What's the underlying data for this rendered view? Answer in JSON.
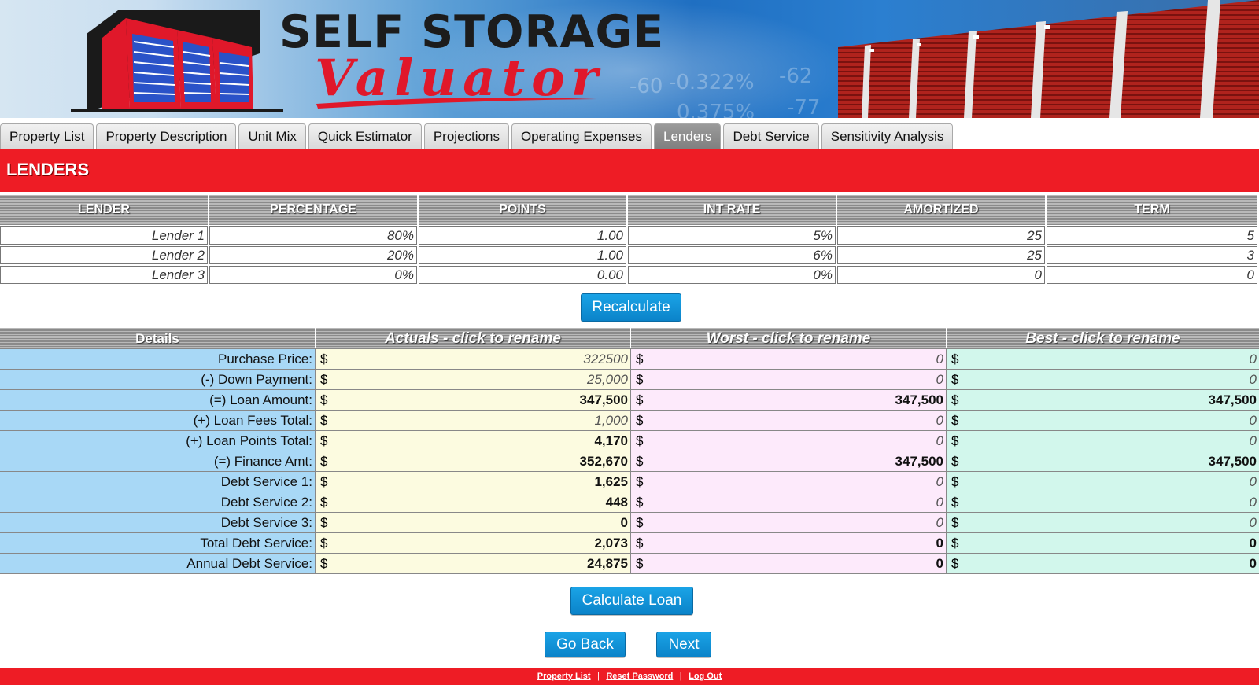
{
  "brand": {
    "line1": "SELF STORAGE",
    "line2": "Valuator"
  },
  "banner_ticker": [
    "-60",
    "-0.322%",
    "-62",
    "0.375%",
    "-77"
  ],
  "tabs": [
    {
      "label": "Property List"
    },
    {
      "label": "Property Description"
    },
    {
      "label": "Unit Mix"
    },
    {
      "label": "Quick Estimator"
    },
    {
      "label": "Projections"
    },
    {
      "label": "Operating Expenses"
    },
    {
      "label": "Lenders",
      "active": true
    },
    {
      "label": "Debt Service"
    },
    {
      "label": "Sensitivity Analysis"
    }
  ],
  "section": {
    "title": "LENDERS"
  },
  "lenders_table": {
    "headers": [
      "LENDER",
      "PERCENTAGE",
      "POINTS",
      "INT RATE",
      "AMORTIZED",
      "TERM"
    ],
    "rows": [
      [
        "Lender 1",
        "80%",
        "1.00",
        "5%",
        "25",
        "5"
      ],
      [
        "Lender 2",
        "20%",
        "1.00",
        "6%",
        "25",
        "3"
      ],
      [
        "Lender 3",
        "0%",
        "0.00",
        "0%",
        "0",
        "0"
      ]
    ]
  },
  "buttons": {
    "recalculate": "Recalculate",
    "calculate_loan": "Calculate Loan",
    "go_back": "Go Back",
    "next": "Next"
  },
  "details_table": {
    "headers": {
      "details": "Details",
      "actuals": "Actuals - click to rename",
      "worst": "Worst - click to rename",
      "best": "Best - click to rename"
    },
    "currency": "$",
    "rows": [
      {
        "label": "Purchase Price:",
        "actuals": "322500",
        "worst": "0",
        "best": "0",
        "bold": false
      },
      {
        "label": "(-) Down Payment:",
        "actuals": "25,000",
        "worst": "0",
        "best": "0",
        "bold": false
      },
      {
        "label": "(=) Loan Amount:",
        "actuals": "347,500",
        "worst": "347,500",
        "best": "347,500",
        "bold": true
      },
      {
        "label": "(+) Loan Fees Total:",
        "actuals": "1,000",
        "worst": "0",
        "best": "0",
        "bold": false
      },
      {
        "label": "(+) Loan Points Total:",
        "actuals": "4,170",
        "worst": "0",
        "best": "0",
        "bold": "actuals"
      },
      {
        "label": "(=) Finance Amt:",
        "actuals": "352,670",
        "worst": "347,500",
        "best": "347,500",
        "bold": true
      },
      {
        "label": "Debt Service 1:",
        "actuals": "1,625",
        "worst": "0",
        "best": "0",
        "bold": "actuals"
      },
      {
        "label": "Debt Service 2:",
        "actuals": "448",
        "worst": "0",
        "best": "0",
        "bold": "actuals"
      },
      {
        "label": "Debt Service 3:",
        "actuals": "0",
        "worst": "0",
        "best": "0",
        "bold": "actuals"
      },
      {
        "label": "Total Debt Service:",
        "actuals": "2,073",
        "worst": "0",
        "best": "0",
        "bold": true
      },
      {
        "label": "Annual Debt Service:",
        "actuals": "24,875",
        "worst": "0",
        "best": "0",
        "bold": true
      }
    ]
  },
  "footer": {
    "links": [
      "Property List",
      "Reset Password",
      "Log Out"
    ],
    "separator": "|"
  },
  "colors": {
    "brand_red": "#ee1c25",
    "button_blue": "#0b83c9",
    "label_blue": "#a8d8f6",
    "actuals_bg": "#fcfbe0",
    "worst_bg": "#fdeafb",
    "best_bg": "#d2f7ec"
  }
}
